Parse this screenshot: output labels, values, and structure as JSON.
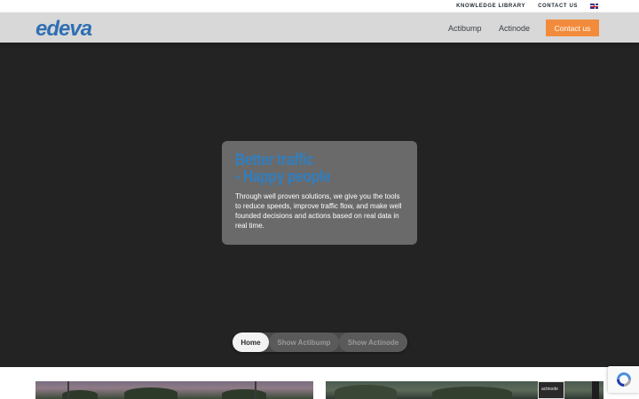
{
  "topbar": {
    "knowledge_library": "KNOWLEDGE LIBRARY",
    "contact_us": "CONTACT US",
    "language_flag": "uk-flag-icon"
  },
  "navbar": {
    "logo_text": "edeva",
    "links": [
      "Actibump",
      "Actinode"
    ],
    "contact_button": "Contact us",
    "accent_color": "#f28c3c",
    "brand_color": "#2f6fb3"
  },
  "hero": {
    "title_line1": "Better traffic",
    "title_line2": "- Happy people",
    "text": "Through well proven solutions, we give you the tools to reduce speeds, improve traffic flow, and make well founded decisions and actions based on real data in real time.",
    "title_color": "#2f7fc1"
  },
  "tabs": {
    "items": [
      "Home",
      "Show Actibump",
      "Show Actinode"
    ],
    "active": "Home"
  },
  "thumbnails": {
    "actinode_label": "actinode"
  },
  "recaptcha": {
    "icon": "recaptcha-icon"
  }
}
